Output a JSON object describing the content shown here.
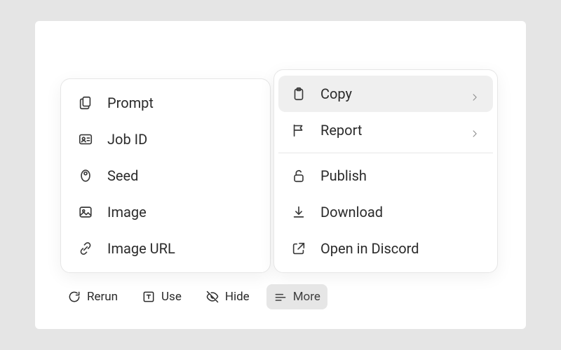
{
  "toolbar": {
    "rerun_label": "Rerun",
    "use_label": "Use",
    "hide_label": "Hide",
    "more_label": "More"
  },
  "copy_menu": {
    "items": [
      {
        "label": "Prompt",
        "icon": "documents-icon"
      },
      {
        "label": "Job ID",
        "icon": "id-card-icon"
      },
      {
        "label": "Seed",
        "icon": "seed-icon"
      },
      {
        "label": "Image",
        "icon": "image-icon"
      },
      {
        "label": "Image URL",
        "icon": "link-icon"
      }
    ]
  },
  "more_menu": {
    "items": [
      {
        "label": "Copy",
        "icon": "clipboard-icon",
        "submenu": true,
        "highlight": true
      },
      {
        "label": "Report",
        "icon": "flag-icon",
        "submenu": true
      },
      {
        "separator": true
      },
      {
        "label": "Publish",
        "icon": "unlock-icon"
      },
      {
        "label": "Download",
        "icon": "download-icon"
      },
      {
        "label": "Open in Discord",
        "icon": "external-link-icon"
      }
    ]
  }
}
